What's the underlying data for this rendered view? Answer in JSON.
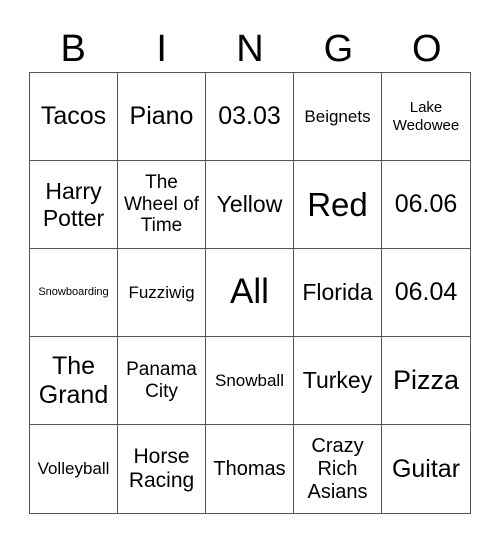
{
  "header": {
    "letters": [
      "B",
      "I",
      "N",
      "G",
      "O"
    ]
  },
  "cells": [
    [
      "Tacos",
      "Piano",
      "03.03",
      "Beignets",
      "Lake Wedowee"
    ],
    [
      "Harry Potter",
      "The Wheel of Time",
      "Yellow",
      "Red",
      "06.06"
    ],
    [
      "Snowboarding",
      "Fuzziwig",
      "All",
      "Florida",
      "06.04"
    ],
    [
      "The Grand",
      "Panama City",
      "Snowball",
      "Turkey",
      "Pizza"
    ],
    [
      "Volleyball",
      "Horse Racing",
      "Thomas",
      "Crazy Rich Asians",
      "Guitar"
    ]
  ]
}
